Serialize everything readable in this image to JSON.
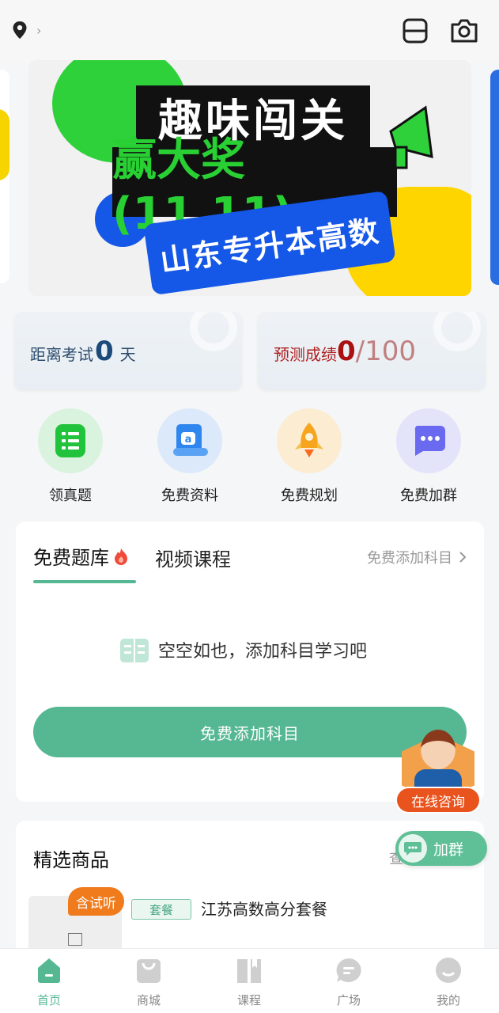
{
  "topbar": {
    "location_icon": "location-pin-icon",
    "chevron": "›",
    "scan_icon": "scan-icon",
    "camera_icon": "camera-icon"
  },
  "banner": {
    "title_line1": "趣味闯关",
    "title_line2": "赢大奖(11.11)",
    "ribbon": "山东专升本高数",
    "slide_indicator_active": 1,
    "slide_count": 3
  },
  "stats": {
    "exam": {
      "label": "距离考试",
      "value": "0",
      "unit": "天"
    },
    "score": {
      "label": "预测成绩",
      "value": "0",
      "total": "/100"
    }
  },
  "quick_actions": [
    {
      "label": "领真题",
      "icon": "exam-paper-icon"
    },
    {
      "label": "免费资料",
      "icon": "document-scroll-icon"
    },
    {
      "label": "免费规划",
      "icon": "rocket-icon"
    },
    {
      "label": "免费加群",
      "icon": "chat-bubble-icon"
    }
  ],
  "study": {
    "tab_active": "免费题库",
    "tab_other": "视频课程",
    "add_link": "免费添加科目",
    "empty_text": "空空如也，添加科目学习吧",
    "button": "免费添加科目"
  },
  "products": {
    "title": "精选商品",
    "more": "查",
    "item": {
      "badge": "含试听",
      "tag": "套餐",
      "name": "江苏高数高分套餐"
    }
  },
  "float": {
    "consult": "在线咨询",
    "join": "加群"
  },
  "tabbar": [
    {
      "label": "首页",
      "icon": "home-icon",
      "active": true
    },
    {
      "label": "商城",
      "icon": "shopping-bag-icon",
      "active": false
    },
    {
      "label": "课程",
      "icon": "book-icon",
      "active": false
    },
    {
      "label": "广场",
      "icon": "message-icon",
      "active": false
    },
    {
      "label": "我的",
      "icon": "profile-icon",
      "active": false
    }
  ],
  "colors": {
    "accent": "#55b893",
    "orange": "#f07b1c",
    "score_red": "#a11111"
  }
}
